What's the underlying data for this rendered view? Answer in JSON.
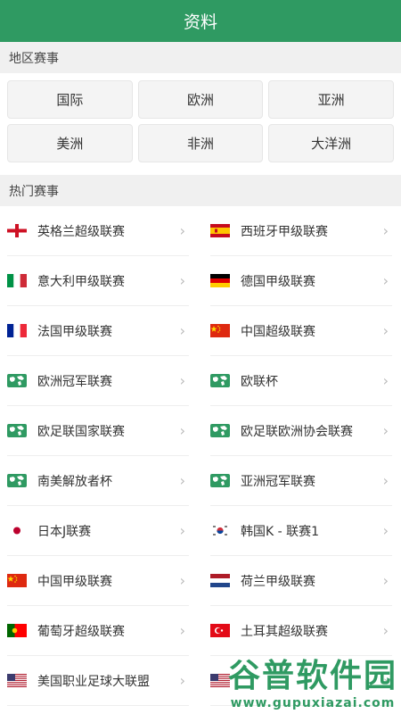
{
  "header": {
    "title": "资料"
  },
  "regions": {
    "title": "地区赛事",
    "items": [
      "国际",
      "欧洲",
      "亚洲",
      "美洲",
      "非洲",
      "大洋洲"
    ]
  },
  "hot": {
    "title": "热门赛事",
    "leagues": [
      {
        "name": "英格兰超级联赛",
        "flag": "england"
      },
      {
        "name": "西班牙甲级联赛",
        "flag": "spain"
      },
      {
        "name": "意大利甲级联赛",
        "flag": "italy"
      },
      {
        "name": "德国甲级联赛",
        "flag": "germany"
      },
      {
        "name": "法国甲级联赛",
        "flag": "france"
      },
      {
        "name": "中国超级联赛",
        "flag": "china"
      },
      {
        "name": "欧洲冠军联赛",
        "flag": "world"
      },
      {
        "name": "欧联杯",
        "flag": "world"
      },
      {
        "name": "欧足联国家联赛",
        "flag": "world"
      },
      {
        "name": "欧足联欧洲协会联赛",
        "flag": "world"
      },
      {
        "name": "南美解放者杯",
        "flag": "world"
      },
      {
        "name": "亚洲冠军联赛",
        "flag": "world"
      },
      {
        "name": "日本J联赛",
        "flag": "japan"
      },
      {
        "name": "韩国K - 联赛1",
        "flag": "korea"
      },
      {
        "name": "中国甲级联赛",
        "flag": "china"
      },
      {
        "name": "荷兰甲级联赛",
        "flag": "netherlands"
      },
      {
        "name": "葡萄牙超级联赛",
        "flag": "portugal"
      },
      {
        "name": "土耳其超级联赛",
        "flag": "turkey"
      },
      {
        "name": "美国职业足球大联盟",
        "flag": "usa"
      },
      {
        "name": "",
        "flag": "usa"
      }
    ]
  },
  "watermark": {
    "big": "谷普软件园",
    "small": "www.gupuxiazai.com"
  },
  "colors": {
    "accent": "#2f9a62"
  }
}
